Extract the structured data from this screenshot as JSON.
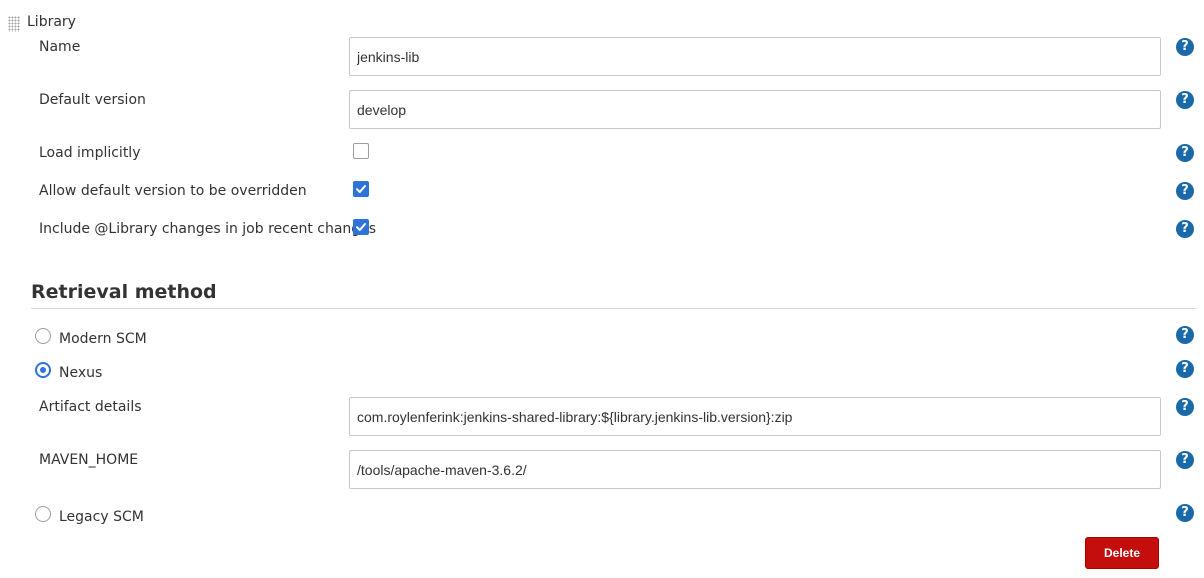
{
  "library": {
    "section_label": "Library",
    "name_label": "Name",
    "name_value": "jenkins-lib",
    "default_version_label": "Default version",
    "default_version_value": "develop",
    "load_implicitly_label": "Load implicitly",
    "load_implicitly_checked": false,
    "allow_override_label": "Allow default version to be overridden",
    "allow_override_checked": true,
    "include_changes_label": "Include @Library changes in job recent changes",
    "include_changes_checked": true
  },
  "retrieval": {
    "heading": "Retrieval method",
    "options": [
      {
        "label": "Modern SCM",
        "selected": false
      },
      {
        "label": "Nexus",
        "selected": true
      },
      {
        "label": "Legacy SCM",
        "selected": false
      }
    ],
    "artifact_label": "Artifact details",
    "artifact_value": "com.roylenferink:jenkins-shared-library:${library.jenkins-lib.version}:zip",
    "maven_home_label": "MAVEN_HOME",
    "maven_home_value": "/tools/apache-maven-3.6.2/"
  },
  "help_glyph": "?",
  "delete_label": "Delete",
  "colors": {
    "accent": "#2e73d9",
    "help": "#1b6aa8",
    "delete": "#c40d0d"
  }
}
